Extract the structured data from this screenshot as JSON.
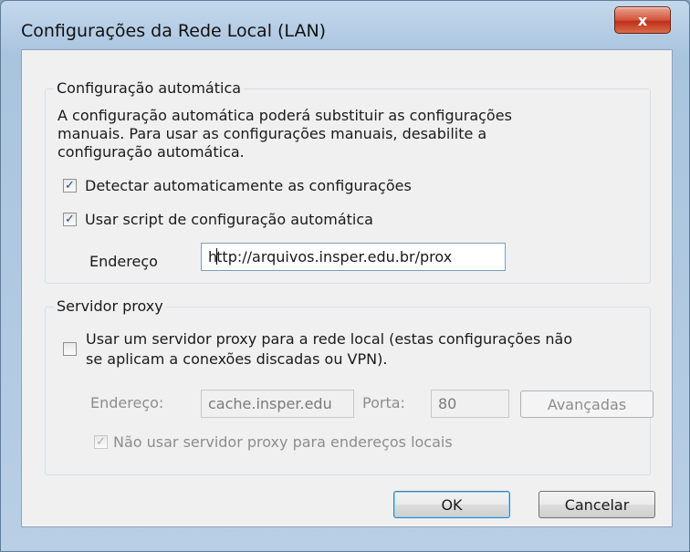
{
  "window": {
    "title": "Configurações da Rede Local (LAN)",
    "close_label": "x"
  },
  "auto_config": {
    "legend": "Configuração automática",
    "description_lines": [
      "A configuração automática poderá substituir as configurações",
      "manuais. Para usar as configurações manuais, desabilite a",
      "configuração automática."
    ],
    "detect_label": "Detectar automaticamente as configurações",
    "detect_checked": true,
    "script_label": "Usar script de configuração automática",
    "script_checked": true,
    "address_label": "Endereço",
    "address_value_before_caret": "h",
    "address_value_after_caret": "ttp://arquivos.insper.edu.br/prox"
  },
  "proxy": {
    "legend": "Servidor proxy",
    "use_proxy_label_lines": [
      "Usar um servidor proxy para a rede local (estas configurações não",
      "se aplicam a conexões discadas ou VPN)."
    ],
    "use_proxy_checked": false,
    "address_label": "Endereço:",
    "address_value": "cache.insper.edu",
    "port_label": "Porta:",
    "port_value": "80",
    "advanced_label": "Avançadas",
    "bypass_local_label": "Não usar servidor proxy para endereços locais",
    "bypass_local_checked": true
  },
  "buttons": {
    "ok_label": "OK",
    "cancel_label": "Cancelar"
  },
  "icons": {
    "check": "✓"
  }
}
